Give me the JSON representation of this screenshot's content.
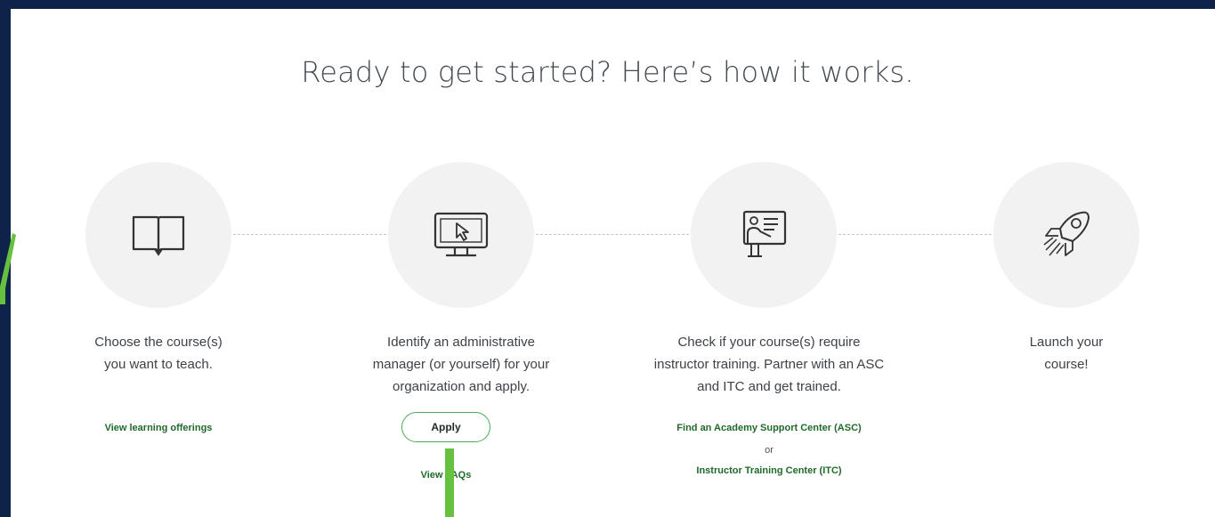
{
  "heading": "Ready to get started? Here’s how it works.",
  "steps": [
    {
      "icon": "open-book-icon",
      "text_line1": "Choose the course(s)",
      "text_line2": "you want to teach.",
      "link": "View learning offerings"
    },
    {
      "icon": "monitor-cursor-icon",
      "text_line1": "Identify an administrative",
      "text_line2": "manager (or yourself) for your",
      "text_line3": "organization and apply.",
      "button": "Apply",
      "link": "View FAQs"
    },
    {
      "icon": "instructor-board-icon",
      "text_line1": "Check if your course(s) require",
      "text_line2": "instructor training. Partner with an ASC",
      "text_line3": "and ITC and get trained.",
      "link1": "Find an Academy Support Center (ASC)",
      "or": "or",
      "link2": "Instructor Training Center (ITC)"
    },
    {
      "icon": "rocket-icon",
      "text_line1": "Launch your",
      "text_line2": "course!"
    }
  ],
  "colors": {
    "background": "#0d2347",
    "link": "#1f6a2a",
    "button_border": "#49a95a",
    "annotation": "#67c140"
  }
}
